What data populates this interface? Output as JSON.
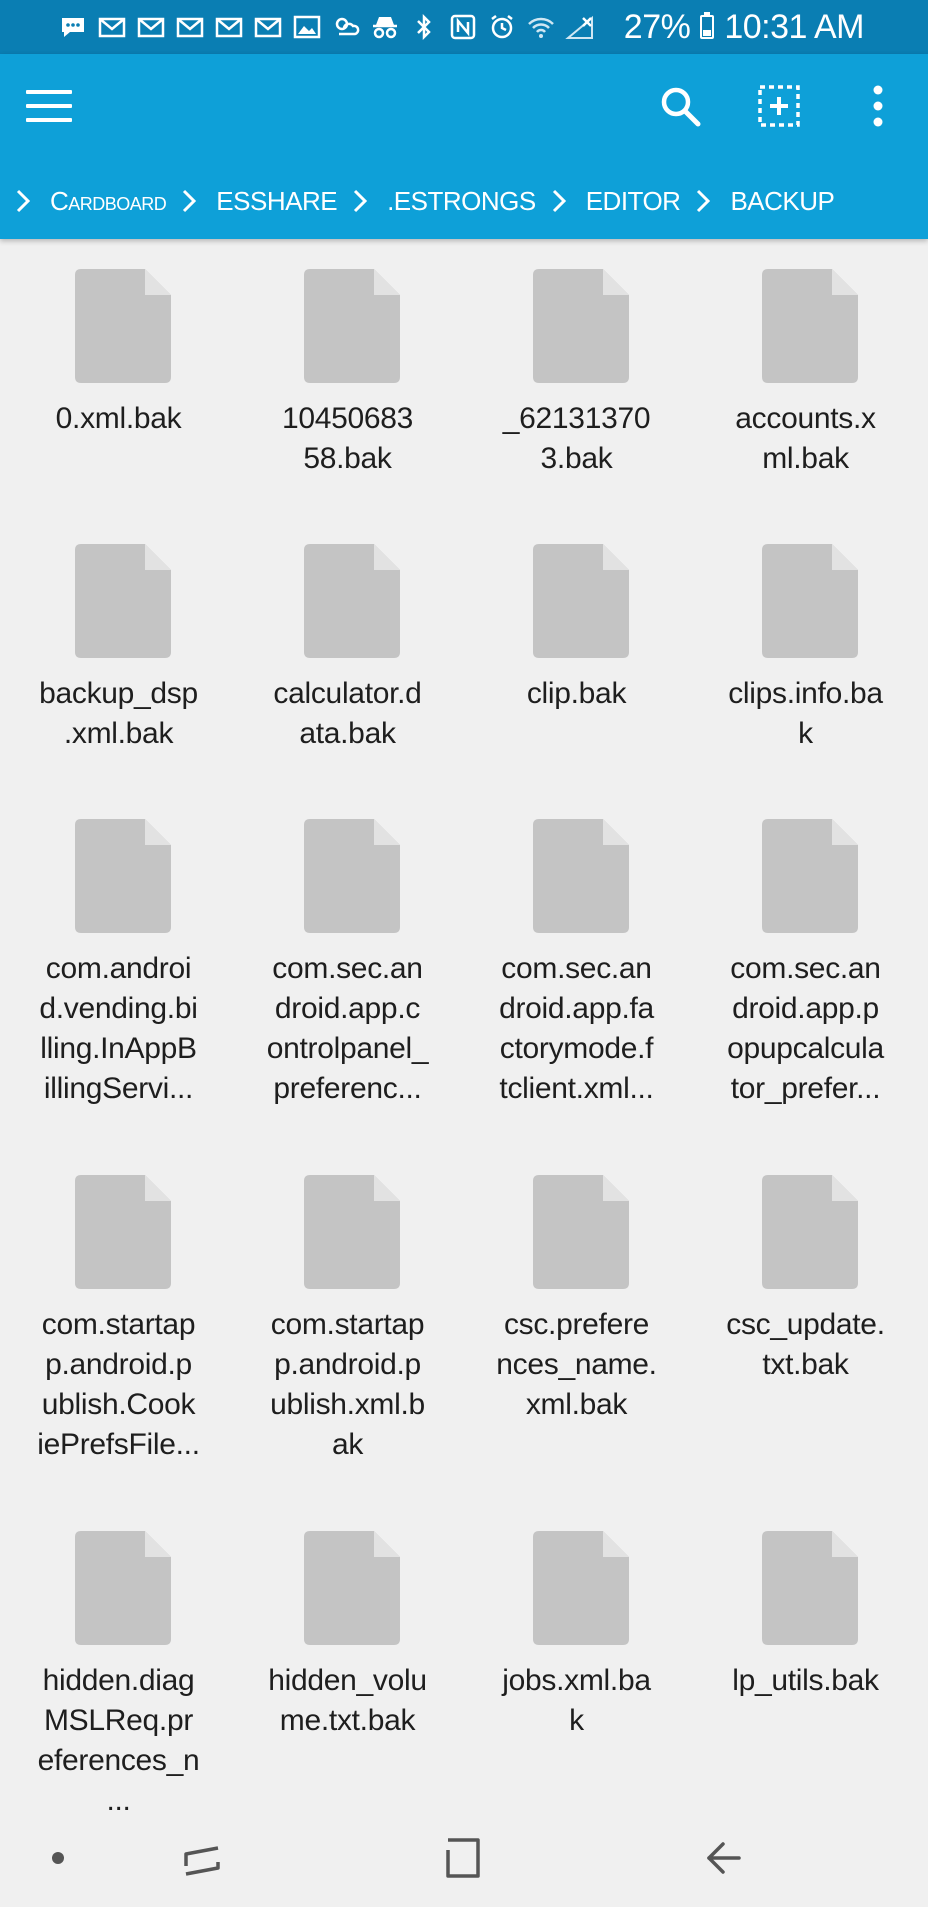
{
  "status_bar": {
    "icons": [
      "chat-icon",
      "mail-icon",
      "mail-icon",
      "mail-icon",
      "mail-icon",
      "mail-icon",
      "image-icon",
      "weather-icon",
      "incognito-icon",
      "bluetooth-icon",
      "nfc-icon",
      "alarm-icon",
      "wifi-icon",
      "signal-off-icon"
    ],
    "battery": "27%",
    "time": "10:31 AM"
  },
  "app_bar": {
    "menu_icon": "hamburger-menu-icon",
    "search_icon": "search-icon",
    "select_icon": "select-all-icon",
    "more_icon": "more-vert-icon"
  },
  "breadcrumb": [
    "Cardboard",
    "ESSHARE",
    ".ESTRONGS",
    "EDITOR",
    "BACKUP"
  ],
  "files": [
    {
      "lines": [
        "0.xml.bak"
      ]
    },
    {
      "lines": [
        "10450683",
        "58.bak"
      ]
    },
    {
      "lines": [
        "_62131370",
        "3.bak"
      ]
    },
    {
      "lines": [
        "accounts.x",
        "ml.bak"
      ]
    },
    {
      "lines": [
        "backup_dsp",
        ".xml.bak"
      ]
    },
    {
      "lines": [
        "calculator.d",
        "ata.bak"
      ]
    },
    {
      "lines": [
        "clip.bak"
      ]
    },
    {
      "lines": [
        "clips.info.ba",
        "k"
      ]
    },
    {
      "lines": [
        "com.androi",
        "d.vending.bi",
        "lling.InAppB",
        "illingServi..."
      ]
    },
    {
      "lines": [
        "com.sec.an",
        "droid.app.c",
        "ontrolpanel_",
        "preferenc..."
      ]
    },
    {
      "lines": [
        "com.sec.an",
        "droid.app.fa",
        "ctorymode.f",
        "tclient.xml..."
      ]
    },
    {
      "lines": [
        "com.sec.an",
        "droid.app.p",
        "opupcalcula",
        "tor_prefer..."
      ]
    },
    {
      "lines": [
        "com.startap",
        "p.android.p",
        "ublish.Cook",
        "iePrefsFile..."
      ]
    },
    {
      "lines": [
        "com.startap",
        "p.android.p",
        "ublish.xml.b",
        "ak"
      ]
    },
    {
      "lines": [
        "csc.prefere",
        "nces_name.",
        "xml.bak"
      ]
    },
    {
      "lines": [
        "csc_update.",
        "txt.bak"
      ]
    },
    {
      "lines": [
        "hidden.diag",
        "MSLReq.pr",
        "eferences_n",
        "..."
      ]
    },
    {
      "lines": [
        "hidden_volu",
        "me.txt.bak"
      ]
    },
    {
      "lines": [
        "jobs.xml.ba",
        "k"
      ]
    },
    {
      "lines": [
        "lp_utils.bak"
      ]
    }
  ],
  "nav_bar": {
    "dot_icon": "dot-icon",
    "recents_icon": "recents-icon",
    "home_icon": "home-icon",
    "back_icon": "back-icon"
  }
}
